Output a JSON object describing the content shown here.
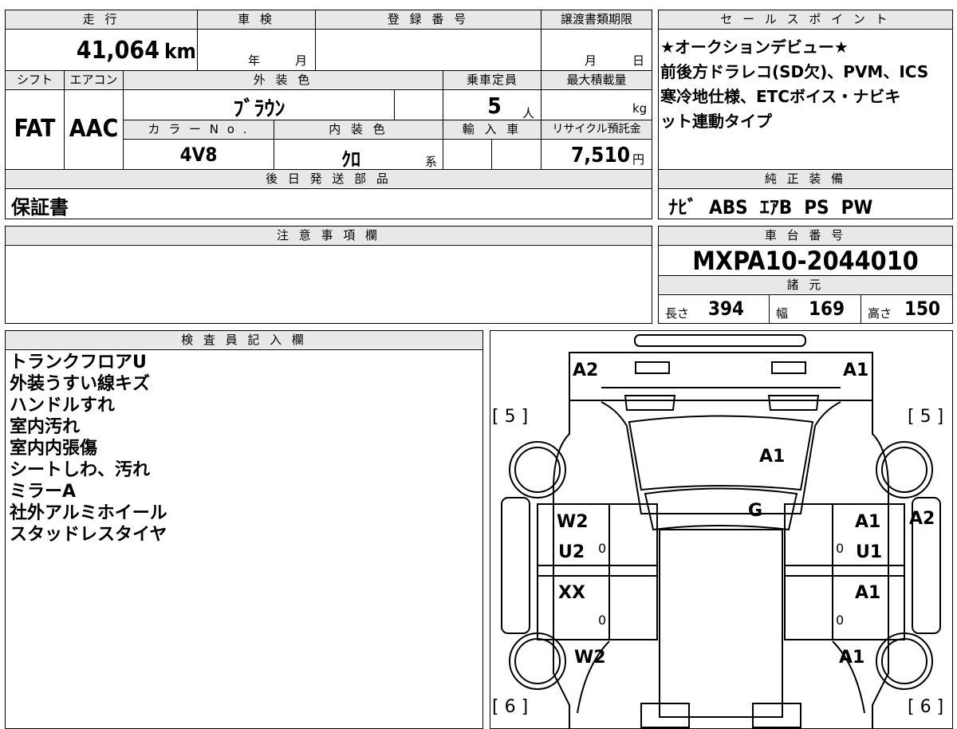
{
  "header": {
    "mileage_label": "走 行",
    "inspection_label": "車 検",
    "registration_label": "登 録 番 号",
    "transfer_label": "譲渡書類期限",
    "mileage_value": "41,064",
    "mileage_unit": "km",
    "inspection_year_unit": "年",
    "inspection_month_unit": "月",
    "transfer_month_unit": "月",
    "transfer_day_unit": "日"
  },
  "specs": {
    "shift_label": "シフト",
    "aircon_label": "エアコン",
    "exterior_color_label": "外 装 色",
    "capacity_label": "乗車定員",
    "max_load_label": "最大積載量",
    "shift_value": "FAT",
    "aircon_value": "AAC",
    "exterior_color_value": "ﾌﾞﾗｳﾝ",
    "capacity_value": "5",
    "capacity_unit": "人",
    "max_load_unit": "kg",
    "color_no_label": "カ ラ ー N o .",
    "interior_color_label": "内 装 色",
    "import_label": "輸 入 車",
    "recycle_label": "リサイクル預託金",
    "color_no_value": "4V8",
    "interior_color_value": "ｸﾛ",
    "interior_color_suffix": "系",
    "recycle_value": "7,510",
    "recycle_unit": "円"
  },
  "later_parts": {
    "label": "後 日 発 送 部 品",
    "value": "保証書"
  },
  "notes": {
    "label": "注 意 事 項 欄"
  },
  "sales_points": {
    "label": "セ ー ル ス ポ イ ン ト",
    "lines": [
      "★オークションデビュー★",
      "前後方ドラレコ(SD欠)、PVM、ICS",
      "寒冷地仕様、ETCボイス・ナビキ",
      "ット連動タイプ"
    ]
  },
  "standard_equipment": {
    "label": "純 正 装 備",
    "value": "ﾅﾋﾞ  ABS  ｴｱB  PS  PW"
  },
  "chassis": {
    "label": "車 台 番 号",
    "value": "MXPA10-2044010"
  },
  "dimensions": {
    "label": "諸 元",
    "length_label": "長さ",
    "length_value": "394",
    "width_label": "幅",
    "width_value": "169",
    "height_label": "高さ",
    "height_value": "150"
  },
  "inspector": {
    "label": "検 査 員 記 入 欄",
    "lines": [
      "トランクフロアU",
      "外装うすい線キズ",
      "ハンドルすれ",
      "室内汚れ",
      "室内内張傷",
      "シートしわ、汚れ",
      "ミラーA",
      "社外アルミホイール",
      "スタッドレスタイヤ"
    ]
  },
  "diagram": {
    "front_left": "A2",
    "front_right": "A1",
    "bracket_top_left": "[ 5 ]",
    "bracket_top_right": "[ 5 ]",
    "bracket_bottom_left": "[ 6 ]",
    "bracket_bottom_right": "[ 6 ]",
    "hood": "A1",
    "windshield": "G",
    "front_door_left_1": "W2",
    "front_door_left_2": "U2",
    "front_door_right_1": "A1",
    "front_door_right_2": "U1",
    "right_fender": "A2",
    "rear_door_left": "XX",
    "rear_door_right": "A1",
    "rear_quarter_left": "W2",
    "rear_quarter_right": "A1",
    "tread_fl": "0",
    "tread_fr": "0",
    "tread_rl": "0",
    "tread_rr": "0"
  }
}
